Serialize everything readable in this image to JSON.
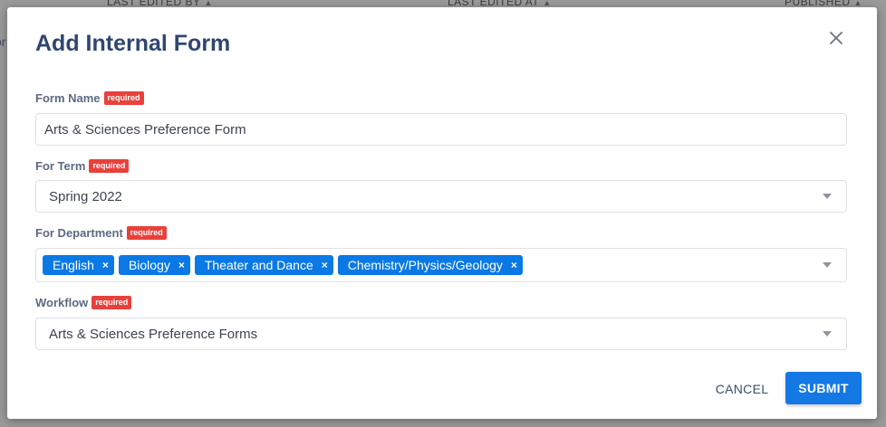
{
  "background": {
    "columns": [
      "LAST EDITED BY",
      "LAST EDITED AT",
      "PUBLISHED"
    ],
    "left_fragment": "or"
  },
  "modal": {
    "title": "Add Internal Form",
    "close_icon": "close-icon",
    "required_badge": "required",
    "fields": {
      "form_name": {
        "label": "Form Name",
        "value": "Arts & Sciences Preference Form"
      },
      "for_term": {
        "label": "For Term",
        "selected": "Spring 2022"
      },
      "for_department": {
        "label": "For Department",
        "tags": [
          "English",
          "Biology",
          "Theater and Dance",
          "Chemistry/Physics/Geology"
        ]
      },
      "workflow": {
        "label": "Workflow",
        "selected": "Arts & Sciences Preference Forms"
      }
    },
    "actions": {
      "cancel_label": "CANCEL",
      "submit_label": "SUBMIT"
    }
  },
  "colors": {
    "title": "#2f4670",
    "badge": "#e8413b",
    "tag": "#0a79e6",
    "submit": "#1478e5"
  }
}
